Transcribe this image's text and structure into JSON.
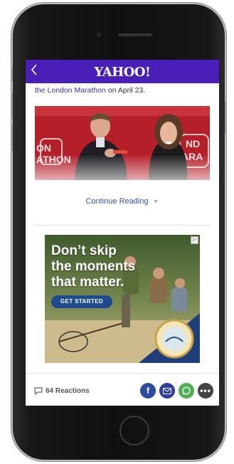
{
  "header": {
    "logo": "YAHOO!",
    "back_icon": "chevron-left-icon",
    "background": "#4a1fb8"
  },
  "article": {
    "lead_link": "the London Marathon",
    "lead_rest": " on April 23.",
    "continue_label": "Continue Reading",
    "photo_banner_left": "ON\nATHON",
    "photo_banner_right": "ND\nARA"
  },
  "ad": {
    "headline_line1": "Don’t skip",
    "headline_line2": "the moments",
    "headline_line3": "that matter.",
    "cta": "GET STARTED",
    "seal_text": "MASSACHUSETTS",
    "ad_choices_icon": "adchoices-icon"
  },
  "footer": {
    "reactions": "64 Reactions",
    "share_icons": [
      "facebook-icon",
      "mail-icon",
      "whatsapp-icon",
      "more-icon"
    ],
    "colors": {
      "facebook": "#2d4da0",
      "mail": "#2f3ea0",
      "whatsapp": "#4caf50",
      "more": "#444444"
    }
  }
}
